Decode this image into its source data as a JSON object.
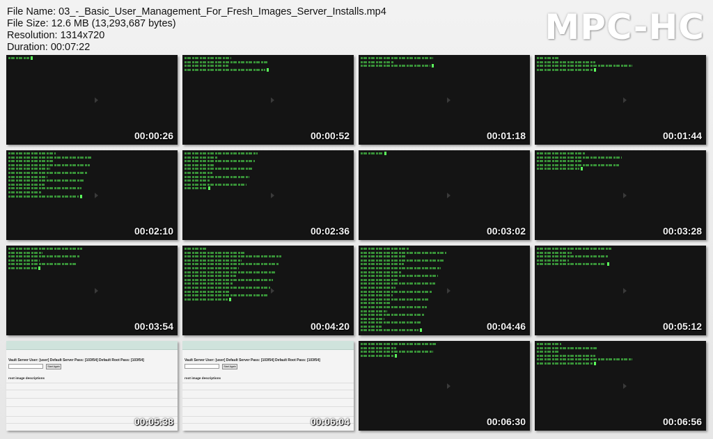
{
  "header": {
    "file_name": "File Name: 03_-_Basic_User_Management_For_Fresh_Images_Server_Installs.mp4",
    "file_size": "File Size: 12.6 MB (13,293,687 bytes)",
    "resolution": "Resolution: 1314x720",
    "duration": "Duration: 00:07:22"
  },
  "logo": "MPC-HC",
  "thumbnails": [
    {
      "time": "00:00:26",
      "kind": "terminal"
    },
    {
      "time": "00:00:52",
      "kind": "terminal"
    },
    {
      "time": "00:01:18",
      "kind": "terminal"
    },
    {
      "time": "00:01:44",
      "kind": "terminal"
    },
    {
      "time": "00:02:10",
      "kind": "terminal"
    },
    {
      "time": "00:02:36",
      "kind": "terminal"
    },
    {
      "time": "00:03:02",
      "kind": "terminal"
    },
    {
      "time": "00:03:28",
      "kind": "terminal"
    },
    {
      "time": "00:03:54",
      "kind": "terminal"
    },
    {
      "time": "00:04:20",
      "kind": "terminal"
    },
    {
      "time": "00:04:46",
      "kind": "terminal"
    },
    {
      "time": "00:05:12",
      "kind": "terminal"
    },
    {
      "time": "00:05:38",
      "kind": "web"
    },
    {
      "time": "00:06:04",
      "kind": "web"
    },
    {
      "time": "00:06:30",
      "kind": "terminal"
    },
    {
      "time": "00:06:56",
      "kind": "terminal"
    }
  ],
  "web_page": {
    "heading": "Vault Server User: [user] Default Server Pass: [103f54] Default Root Pass: [103f54]",
    "button": "Start Again",
    "section": "root image descriptions"
  }
}
